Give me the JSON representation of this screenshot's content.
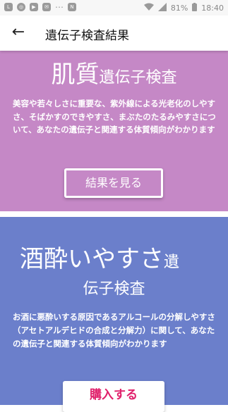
{
  "status_bar": {
    "icons": [
      "line-icon",
      "vpn-icon",
      "youtube-icon",
      "mail-icon",
      "dots-icon",
      "n-icon",
      "wifi-icon",
      "signal-icon"
    ],
    "battery": "81%",
    "time": "18:40"
  },
  "app_bar": {
    "back_icon": "arrow-left-icon",
    "title": "遺伝子検査結果"
  },
  "skin_card": {
    "heading_big": "肌質",
    "heading_small": "遺伝子検査",
    "description": "美容や若々しさに重要な、紫外線による光老化のしやすさ、そばかすのできやすさ、まぶたのたるみやすさについて、あなたの遺伝子と関連する体質傾向がわかります",
    "button_label": "結果を見る",
    "bg_color": "#c588c6"
  },
  "drink_card": {
    "heading_big": "酒酔いやすさ",
    "heading_small_1": "遺",
    "heading_small_2": "伝子検査",
    "description": "お酒に悪酔いする原因であるアルコールの分解しやすさ（アセトアルデヒドの合成と分解力）に関して、あなたの遺伝子と関連する体質傾向がわかります",
    "button_label": "購入する",
    "bg_color": "#6b7fcb",
    "button_text_color": "#e0206b"
  }
}
